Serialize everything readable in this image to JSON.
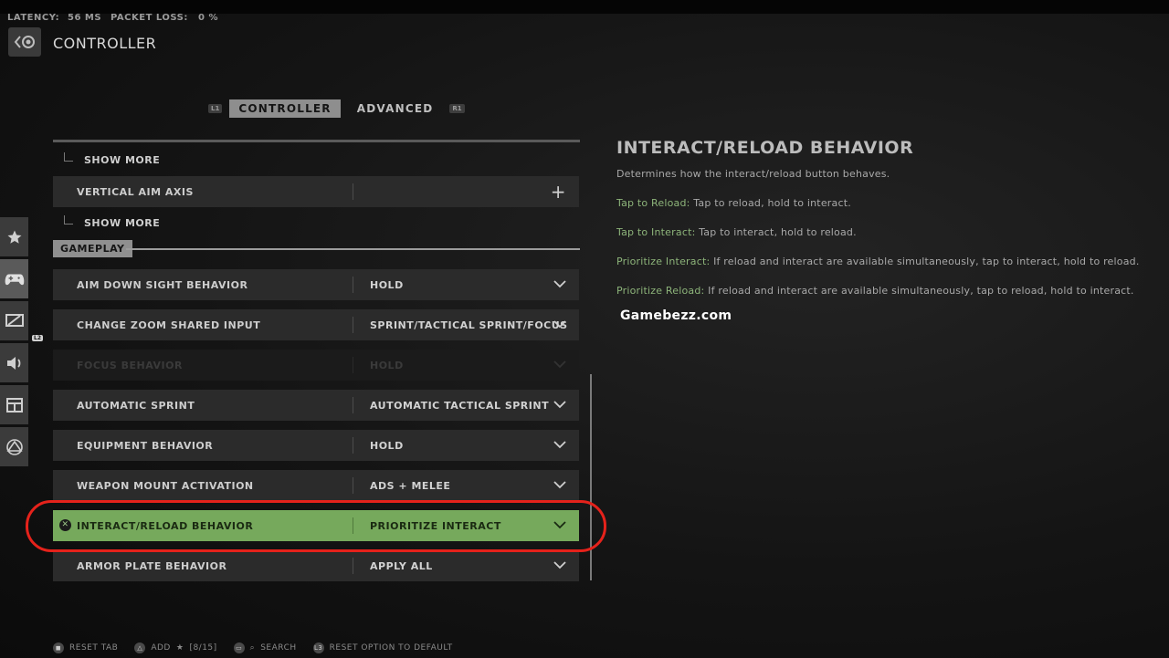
{
  "network": {
    "latency_label": "LATENCY:",
    "latency_value": "56 MS",
    "loss_label": "PACKET LOSS:",
    "loss_value": "0 %"
  },
  "header": {
    "title": "CONTROLLER"
  },
  "tabs": {
    "left_bumper": "L1",
    "right_bumper": "R1",
    "items": [
      {
        "label": "CONTROLLER",
        "active": true
      },
      {
        "label": "ADVANCED",
        "active": false
      }
    ]
  },
  "sidebar": {
    "l2_hint": "L2",
    "items": [
      {
        "icon": "star-icon"
      },
      {
        "icon": "gamepad-icon",
        "active": true
      },
      {
        "icon": "display-icon"
      },
      {
        "icon": "speaker-icon"
      },
      {
        "icon": "interface-icon"
      },
      {
        "icon": "network-icon"
      }
    ]
  },
  "list": {
    "show_more_1": "SHOW MORE",
    "vertical_aim": {
      "label": "VERTICAL AIM AXIS"
    },
    "show_more_2": "SHOW MORE",
    "section_gameplay": "GAMEPLAY",
    "rows": [
      {
        "label": "AIM DOWN SIGHT BEHAVIOR",
        "value": "HOLD"
      },
      {
        "label": "CHANGE ZOOM SHARED INPUT",
        "value": "SPRINT/TACTICAL SPRINT/FOCUS"
      },
      {
        "label": "FOCUS BEHAVIOR",
        "value": "HOLD",
        "disabled": true
      },
      {
        "label": "AUTOMATIC SPRINT",
        "value": "AUTOMATIC TACTICAL SPRINT"
      },
      {
        "label": "EQUIPMENT BEHAVIOR",
        "value": "HOLD"
      },
      {
        "label": "WEAPON MOUNT ACTIVATION",
        "value": "ADS + MELEE"
      },
      {
        "label": "INTERACT/RELOAD BEHAVIOR",
        "value": "PRIORITIZE INTERACT",
        "selected": true
      },
      {
        "label": "ARMOR PLATE BEHAVIOR",
        "value": "APPLY ALL"
      }
    ]
  },
  "description": {
    "title": "INTERACT/RELOAD BEHAVIOR",
    "summary": "Determines how the interact/reload button behaves.",
    "options": [
      {
        "term": "Tap to Reload:",
        "text": " Tap to reload, hold to interact."
      },
      {
        "term": "Tap to Interact:",
        "text": " Tap to interact, hold to reload."
      },
      {
        "term": "Prioritize Interact:",
        "text": " If reload and interact are available simultaneously, tap to interact, hold to reload."
      },
      {
        "term": "Prioritize Reload:",
        "text": " If reload and interact are available simultaneously, tap to reload, hold to interact."
      }
    ]
  },
  "watermark": "Gamebezz.com",
  "footer": {
    "reset_tab": "RESET TAB",
    "add": "ADD",
    "add_count": "[8/15]",
    "search": "SEARCH",
    "reset_option": "RESET OPTION TO DEFAULT",
    "l3": "L3"
  },
  "colors": {
    "selected_row": "#76a95c",
    "highlight_ring": "#e5221b",
    "term_green": "#8db47a"
  }
}
